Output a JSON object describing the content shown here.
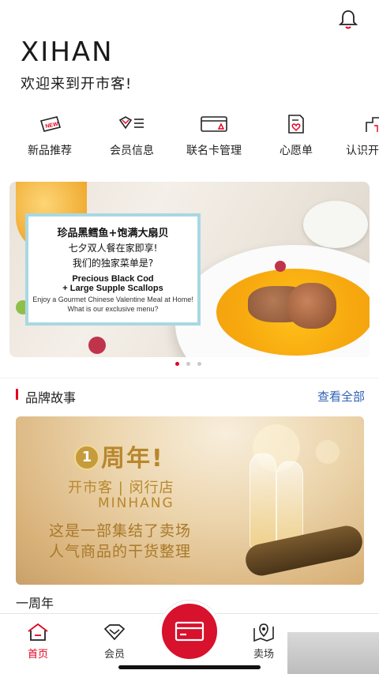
{
  "header": {
    "brand": "XIHAN",
    "welcome": "欢迎来到开市客!"
  },
  "quick_actions": [
    {
      "label": "新品推荐",
      "icon": "new-tag-icon"
    },
    {
      "label": "会员信息",
      "icon": "member-card-icon"
    },
    {
      "label": "联名卡管理",
      "icon": "co-brand-card-icon"
    },
    {
      "label": "心愿单",
      "icon": "wishlist-icon"
    },
    {
      "label": "认识开",
      "icon": "about-icon"
    }
  ],
  "banner": {
    "title_zh": "珍品黑鳕鱼+饱满大扇贝",
    "sub_zh": "七夕双人餐在家即享!",
    "q_zh": "我们的独家菜单是?",
    "title_en_1": "Precious Black Cod",
    "title_en_2": "+ Large Supple Scallops",
    "sub_en": "Enjoy a Gourmet Chinese Valentine Meal at Home! What is our exclusive menu?",
    "dots": 3,
    "active_dot": 0
  },
  "brand_story": {
    "title": "品牌故事",
    "more": "查看全部",
    "card": {
      "badge": "1",
      "anniversary": "周年!",
      "store": "开市客 | 闵行店",
      "store_en": "MINHANG",
      "line1": "这是一部集结了卖场",
      "line2": "人气商品的干货整理"
    },
    "caption": "一周年"
  },
  "tabbar": {
    "tabs": [
      {
        "label": "首页",
        "icon": "home-icon",
        "active": true
      },
      {
        "label": "会员",
        "icon": "member-icon",
        "active": false
      },
      {
        "label": "卖场",
        "icon": "store-location-icon",
        "active": false
      }
    ]
  },
  "colors": {
    "accent": "#e3001f",
    "link": "#2e63b5"
  }
}
